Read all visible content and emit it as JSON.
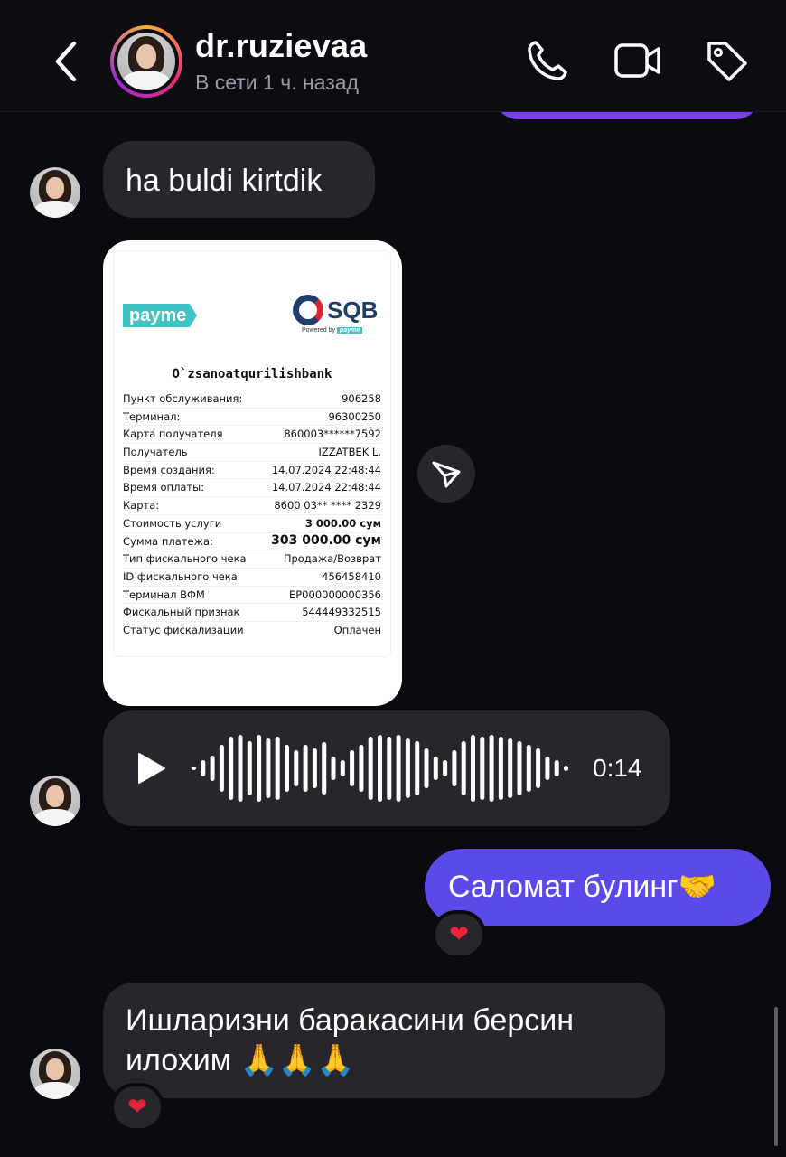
{
  "header": {
    "username": "dr.ruzievaa",
    "status": "В сети 1 ч. назад",
    "icons": [
      "back-chevron-icon",
      "phone-icon",
      "video-call-icon",
      "tag-icon"
    ]
  },
  "colors": {
    "background": "#0a0a10",
    "incoming_bubble": "#26262c",
    "outgoing_bubble": "#5b49e8",
    "accent_purple": "#7a3df0",
    "heart": "#e8213a"
  },
  "messages": {
    "msg1": {
      "text": "ha buldi kirtdik"
    },
    "receipt": {
      "brand_left": "payme",
      "brand_right": "SQB",
      "powered_by": "Powered by",
      "powered_brand": "payme",
      "bank": "O`zsanoatqurilishbank",
      "rows": [
        {
          "k": "Пункт обслуживания:",
          "v": "906258"
        },
        {
          "k": "Терминал:",
          "v": "96300250"
        },
        {
          "k": "Карта получателя",
          "v": "860003******7592"
        },
        {
          "k": "Получатель",
          "v": "IZZATBEK L."
        },
        {
          "k": "Время создания:",
          "v": "14.07.2024 22:48:44"
        },
        {
          "k": "Время оплаты:",
          "v": "14.07.2024 22:48:44"
        },
        {
          "k": "Карта:",
          "v": "8600 03** **** 2329"
        },
        {
          "k": "Стоимость услуги",
          "v": "3 000.00 сум"
        },
        {
          "k": "Сумма платежа:",
          "v": "303 000.00 сум"
        },
        {
          "k": "Тип фискального чека",
          "v": "Продажа/Возврат"
        },
        {
          "k": "ID фискального чека",
          "v": "456458410"
        },
        {
          "k": "Терминал ВФМ",
          "v": "EP000000000356"
        },
        {
          "k": "Фискальный признак",
          "v": "544449332515"
        },
        {
          "k": "Статус фискализации",
          "v": "Оплачен"
        }
      ]
    },
    "voice": {
      "duration": "0:14"
    },
    "outgoing": {
      "text": "Саломат булинг🤝",
      "reaction": "❤"
    },
    "msg3": {
      "line1": "Ишларизни баракасини берсин",
      "line2": "илохим 🙏🙏🙏",
      "reaction": "❤"
    }
  }
}
